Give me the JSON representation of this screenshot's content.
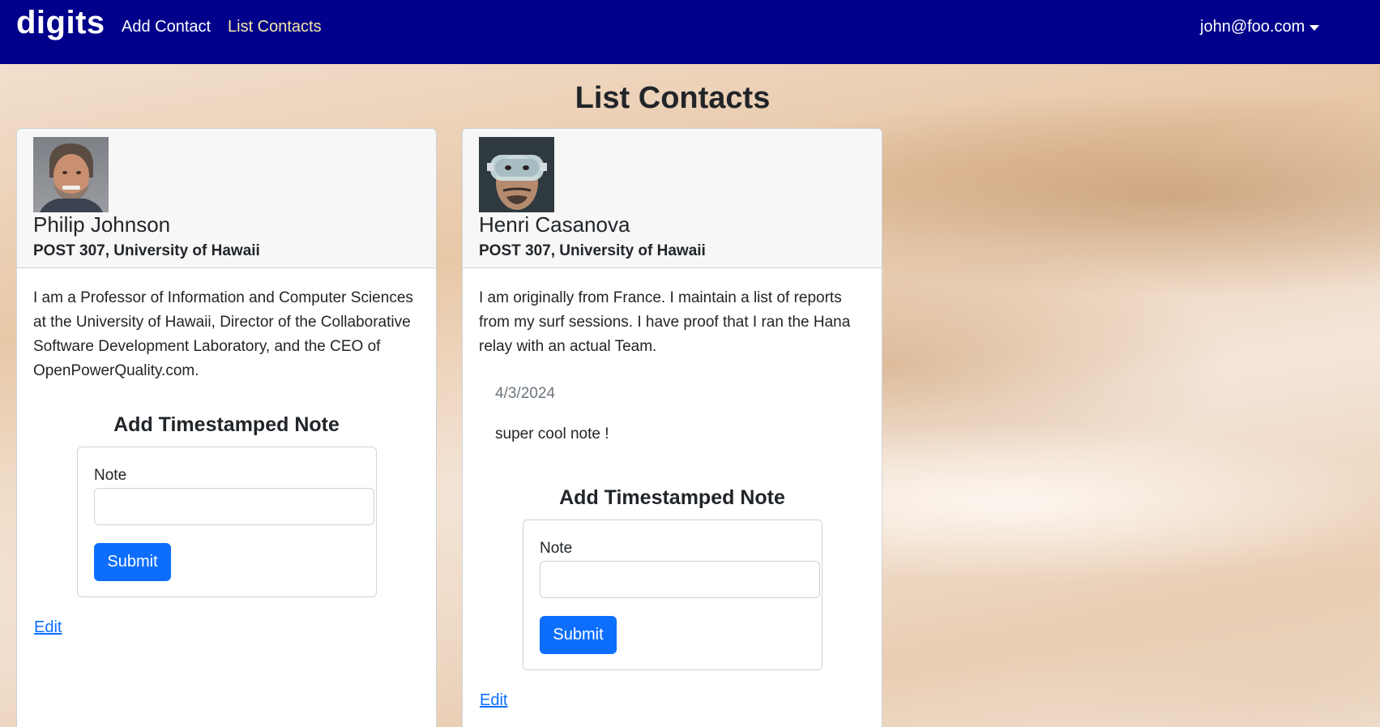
{
  "navbar": {
    "brand": "digits",
    "links": [
      {
        "label": "Add Contact"
      },
      {
        "label": "List Contacts"
      }
    ],
    "user": "john@foo.com"
  },
  "page": {
    "title": "List Contacts"
  },
  "contacts": [
    {
      "name": "Philip Johnson",
      "address": "POST 307, University of Hawaii",
      "description": "I am a Professor of Information and Computer Sciences at the University of Hawaii, Director of the Collaborative Software Development Laboratory, and the CEO of OpenPowerQuality.com.",
      "notes": [],
      "form": {
        "title": "Add Timestamped Note",
        "label": "Note",
        "value": "",
        "submit": "Submit"
      },
      "edit": "Edit"
    },
    {
      "name": "Henri Casanova",
      "address": "POST 307, University of Hawaii",
      "description": "I am originally from France. I maintain a list of reports from my surf sessions. I have proof that I ran the Hana relay with an actual Team.",
      "notes": [
        {
          "date": "4/3/2024",
          "text": "super cool note !"
        }
      ],
      "form": {
        "title": "Add Timestamped Note",
        "label": "Note",
        "value": "",
        "submit": "Submit"
      },
      "edit": "Edit"
    }
  ],
  "colors": {
    "navbar": "#00008b",
    "active_link": "#f5e9a3",
    "primary": "#0d6efd"
  }
}
